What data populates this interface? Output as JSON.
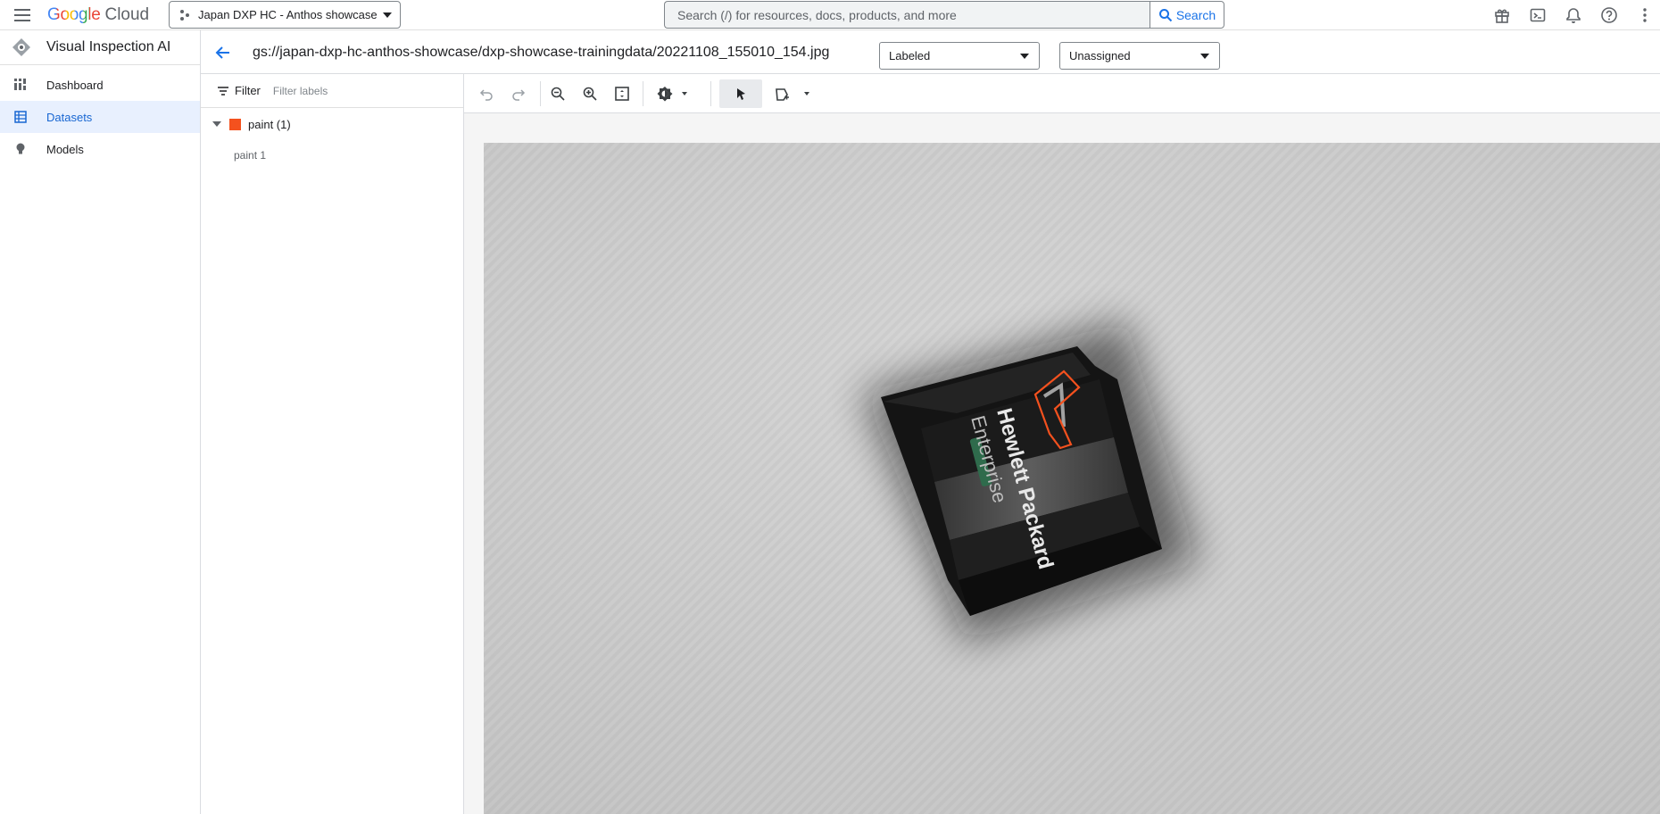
{
  "topbar": {
    "logo_g": "Google",
    "logo_cloud": "Cloud",
    "project_name": "Japan DXP HC - Anthos showcase",
    "search_placeholder": "Search (/) for resources, docs, products, and more",
    "search_button": "Search",
    "icons": [
      "gift-icon",
      "cloud-shell-icon",
      "notifications-icon",
      "help-icon",
      "more-vert-icon"
    ]
  },
  "leftnav": {
    "product_title": "Visual Inspection AI",
    "items": [
      {
        "label": "Dashboard",
        "icon": "dashboard-icon",
        "active": false
      },
      {
        "label": "Datasets",
        "icon": "datasets-icon",
        "active": true
      },
      {
        "label": "Models",
        "icon": "lightbulb-icon",
        "active": false
      }
    ]
  },
  "subheader": {
    "file_path": "gs://japan-dxp-hc-anthos-showcase/dxp-showcase-trainingdata/20221108_155010_154.jpg",
    "label_status": "Labeled",
    "assignment": "Unassigned"
  },
  "labels_panel": {
    "filter_label": "Filter",
    "filter_placeholder": "Filter labels",
    "groups": [
      {
        "name": "paint (1)",
        "color": "#f4511e",
        "children": [
          "paint 1"
        ]
      }
    ]
  },
  "toolbar": {
    "tools": [
      "undo-icon",
      "redo-icon",
      "zoom-out-icon",
      "zoom-in-icon",
      "fit-screen-icon",
      "brightness-icon",
      "select-pointer-icon",
      "polygon-tool-icon"
    ]
  },
  "canvas": {
    "product_text_line1": "Hewlett Packard",
    "product_text_line2": "Enterprise",
    "annotation_color": "#f4511e"
  }
}
